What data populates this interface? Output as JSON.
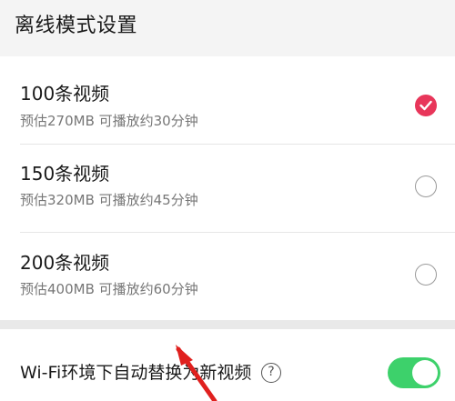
{
  "header": {
    "title": "离线模式设置"
  },
  "options": [
    {
      "title": "100条视频",
      "subtitle": "预估270MB 可播放约30分钟",
      "selected": true
    },
    {
      "title": "150条视频",
      "subtitle": "预估320MB 可播放约45分钟",
      "selected": false
    },
    {
      "title": "200条视频",
      "subtitle": "预估400MB 可播放约60分钟",
      "selected": false
    }
  ],
  "wifi_setting": {
    "label": "Wi-Fi环境下自动替换为新视频",
    "help_icon": "question-circle-icon",
    "help_glyph": "?",
    "enabled": true
  },
  "colors": {
    "accent": "#e8365a",
    "toggle_on": "#3dd16b",
    "annotation_arrow": "#e0201e"
  }
}
